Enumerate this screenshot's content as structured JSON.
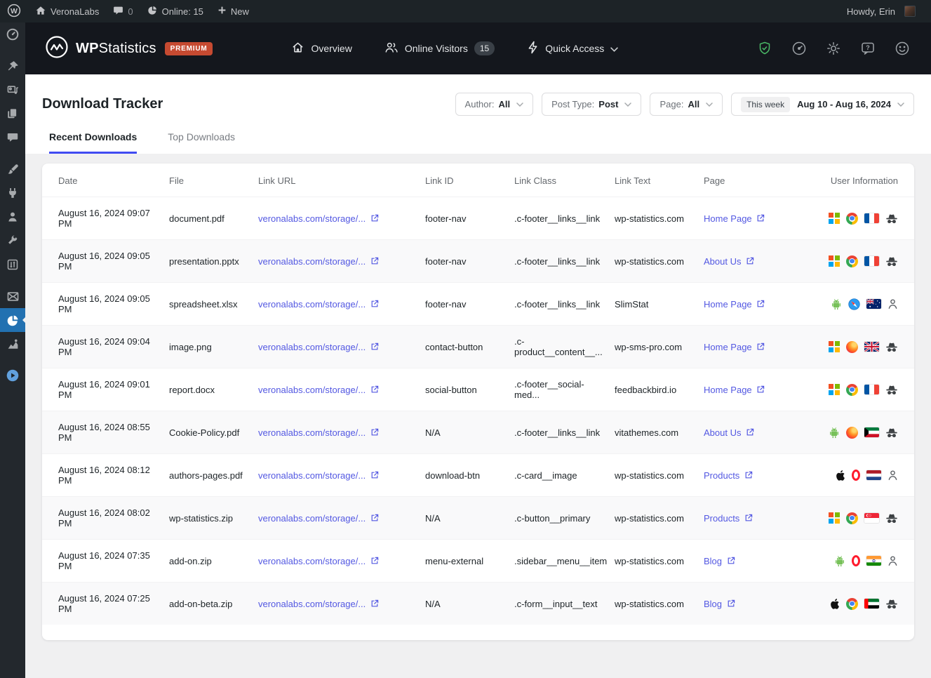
{
  "admin_bar": {
    "site_name": "VeronaLabs",
    "comments_count": "0",
    "online_label": "Online: 15",
    "new_label": "New",
    "howdy": "Howdy, Erin",
    "icons": [
      "wordpress-logo-icon",
      "home-icon",
      "comment-icon",
      "pie-chart-icon",
      "plus-icon"
    ]
  },
  "header": {
    "brand": {
      "wp": "WP",
      "statistics": "Statistics",
      "premium_badge": "PREMIUM"
    },
    "nav": [
      {
        "label": "Overview",
        "icon": "home-outline-icon"
      },
      {
        "label": "Online Visitors",
        "badge": "15",
        "icon": "visitors-icon"
      },
      {
        "label": "Quick Access",
        "icon": "lightning-icon",
        "chevron": true
      }
    ],
    "action_icons": [
      "shield-check-icon",
      "gauge-icon",
      "gear-icon",
      "help-icon",
      "smiley-icon"
    ],
    "colors": {
      "shield_check": "#4ab866",
      "icon_gray": "#9ea3a8",
      "premium_bg": "#c64a31"
    }
  },
  "sidebar": {
    "active_color": "#2271b1",
    "items": [
      {
        "name": "dashboard"
      },
      {
        "name": "posts",
        "gap": true
      },
      {
        "name": "media"
      },
      {
        "name": "pages"
      },
      {
        "name": "comments"
      },
      {
        "name": "appearance",
        "gap": true
      },
      {
        "name": "plugins"
      },
      {
        "name": "users"
      },
      {
        "name": "tools"
      },
      {
        "name": "settings"
      },
      {
        "name": "mail",
        "gap": true
      },
      {
        "name": "statistics",
        "active": true
      },
      {
        "name": "analytics"
      },
      {
        "name": "play",
        "gap": true
      }
    ]
  },
  "page": {
    "title": "Download Tracker",
    "tabs": [
      {
        "label": "Recent Downloads",
        "active": true
      },
      {
        "label": "Top Downloads",
        "active": false
      }
    ],
    "filters": [
      {
        "label": "Author:",
        "value": "All"
      },
      {
        "label": "Post Type:",
        "value": "Post"
      },
      {
        "label": "Page:",
        "value": "All"
      },
      {
        "badge": "This week",
        "value": "Aug 10 - Aug 16, 2024"
      }
    ],
    "accent_color": "#404BF2",
    "link_color": "#5358e2"
  },
  "table": {
    "columns": [
      "Date",
      "File",
      "Link URL",
      "Link ID",
      "Link Class",
      "Link Text",
      "Page",
      "User Information"
    ],
    "rows": [
      {
        "date": "August 16, 2024 09:07 PM",
        "file": "document.pdf",
        "link_url": "veronalabs.com/storage/...",
        "link_id": "footer-nav",
        "link_class": ".c-footer__links__link",
        "link_text": "wp-statistics.com",
        "page": "Home Page",
        "user_info": {
          "os": "windows",
          "browser": "chrome",
          "country": "france",
          "privacy": "incognito"
        }
      },
      {
        "date": "August 16, 2024 09:05 PM",
        "file": "presentation.pptx",
        "link_url": "veronalabs.com/storage/...",
        "link_id": "footer-nav",
        "link_class": ".c-footer__links__link",
        "link_text": "wp-statistics.com",
        "page": "About Us",
        "user_info": {
          "os": "windows",
          "browser": "chrome",
          "country": "france",
          "privacy": "incognito"
        }
      },
      {
        "date": "August 16, 2024 09:05 PM",
        "file": "spreadsheet.xlsx",
        "link_url": "veronalabs.com/storage/...",
        "link_id": "footer-nav",
        "link_class": ".c-footer__links__link",
        "link_text": "SlimStat",
        "page": "Home Page",
        "user_info": {
          "os": "android",
          "browser": "safari",
          "country": "australia",
          "privacy": "user"
        }
      },
      {
        "date": "August 16, 2024 09:04 PM",
        "file": "image.png",
        "link_url": "veronalabs.com/storage/...",
        "link_id": "contact-button",
        "link_class": ".c-product__content__...",
        "link_text": "wp-sms-pro.com",
        "page": "Home Page",
        "user_info": {
          "os": "windows",
          "browser": "firefox",
          "country": "uk",
          "privacy": "incognito"
        }
      },
      {
        "date": "August 16, 2024 09:01 PM",
        "file": "report.docx",
        "link_url": "veronalabs.com/storage/...",
        "link_id": "social-button",
        "link_class": ".c-footer__social-med...",
        "link_text": "feedbackbird.io",
        "page": "Home Page",
        "user_info": {
          "os": "windows",
          "browser": "chrome",
          "country": "france",
          "privacy": "incognito"
        }
      },
      {
        "date": "August 16, 2024 08:55 PM",
        "file": "Cookie-Policy.pdf",
        "link_url": "veronalabs.com/storage/...",
        "link_id": "N/A",
        "link_class": ".c-footer__links__link",
        "link_text": "vitathemes.com",
        "page": "About Us",
        "user_info": {
          "os": "android",
          "browser": "firefox",
          "country": "kuwait",
          "privacy": "incognito"
        }
      },
      {
        "date": "August 16, 2024 08:12 PM",
        "file": "authors-pages.pdf",
        "link_url": "veronalabs.com/storage/...",
        "link_id": "download-btn",
        "link_class": ".c-card__image",
        "link_text": "wp-statistics.com",
        "page": "Products",
        "user_info": {
          "os": "apple",
          "browser": "opera",
          "country": "netherlands",
          "privacy": "user"
        }
      },
      {
        "date": "August 16, 2024 08:02 PM",
        "file": "wp-statistics.zip",
        "link_url": "veronalabs.com/storage/...",
        "link_id": "N/A",
        "link_class": ".c-button__primary",
        "link_text": "wp-statistics.com",
        "page": "Products",
        "user_info": {
          "os": "windows",
          "browser": "chrome",
          "country": "singapore",
          "privacy": "incognito"
        }
      },
      {
        "date": "August 16, 2024 07:35 PM",
        "file": "add-on.zip",
        "link_url": "veronalabs.com/storage/...",
        "link_id": "menu-external",
        "link_class": ".sidebar__menu__item",
        "link_text": "wp-statistics.com",
        "page": "Blog",
        "user_info": {
          "os": "android",
          "browser": "opera",
          "country": "india",
          "privacy": "user"
        }
      },
      {
        "date": "August 16, 2024 07:25 PM",
        "file": "add-on-beta.zip",
        "link_url": "veronalabs.com/storage/...",
        "link_id": "N/A",
        "link_class": ".c-form__input__text",
        "link_text": "wp-statistics.com",
        "page": "Blog",
        "user_info": {
          "os": "apple",
          "browser": "chrome",
          "country": "uae",
          "privacy": "incognito"
        }
      }
    ]
  }
}
